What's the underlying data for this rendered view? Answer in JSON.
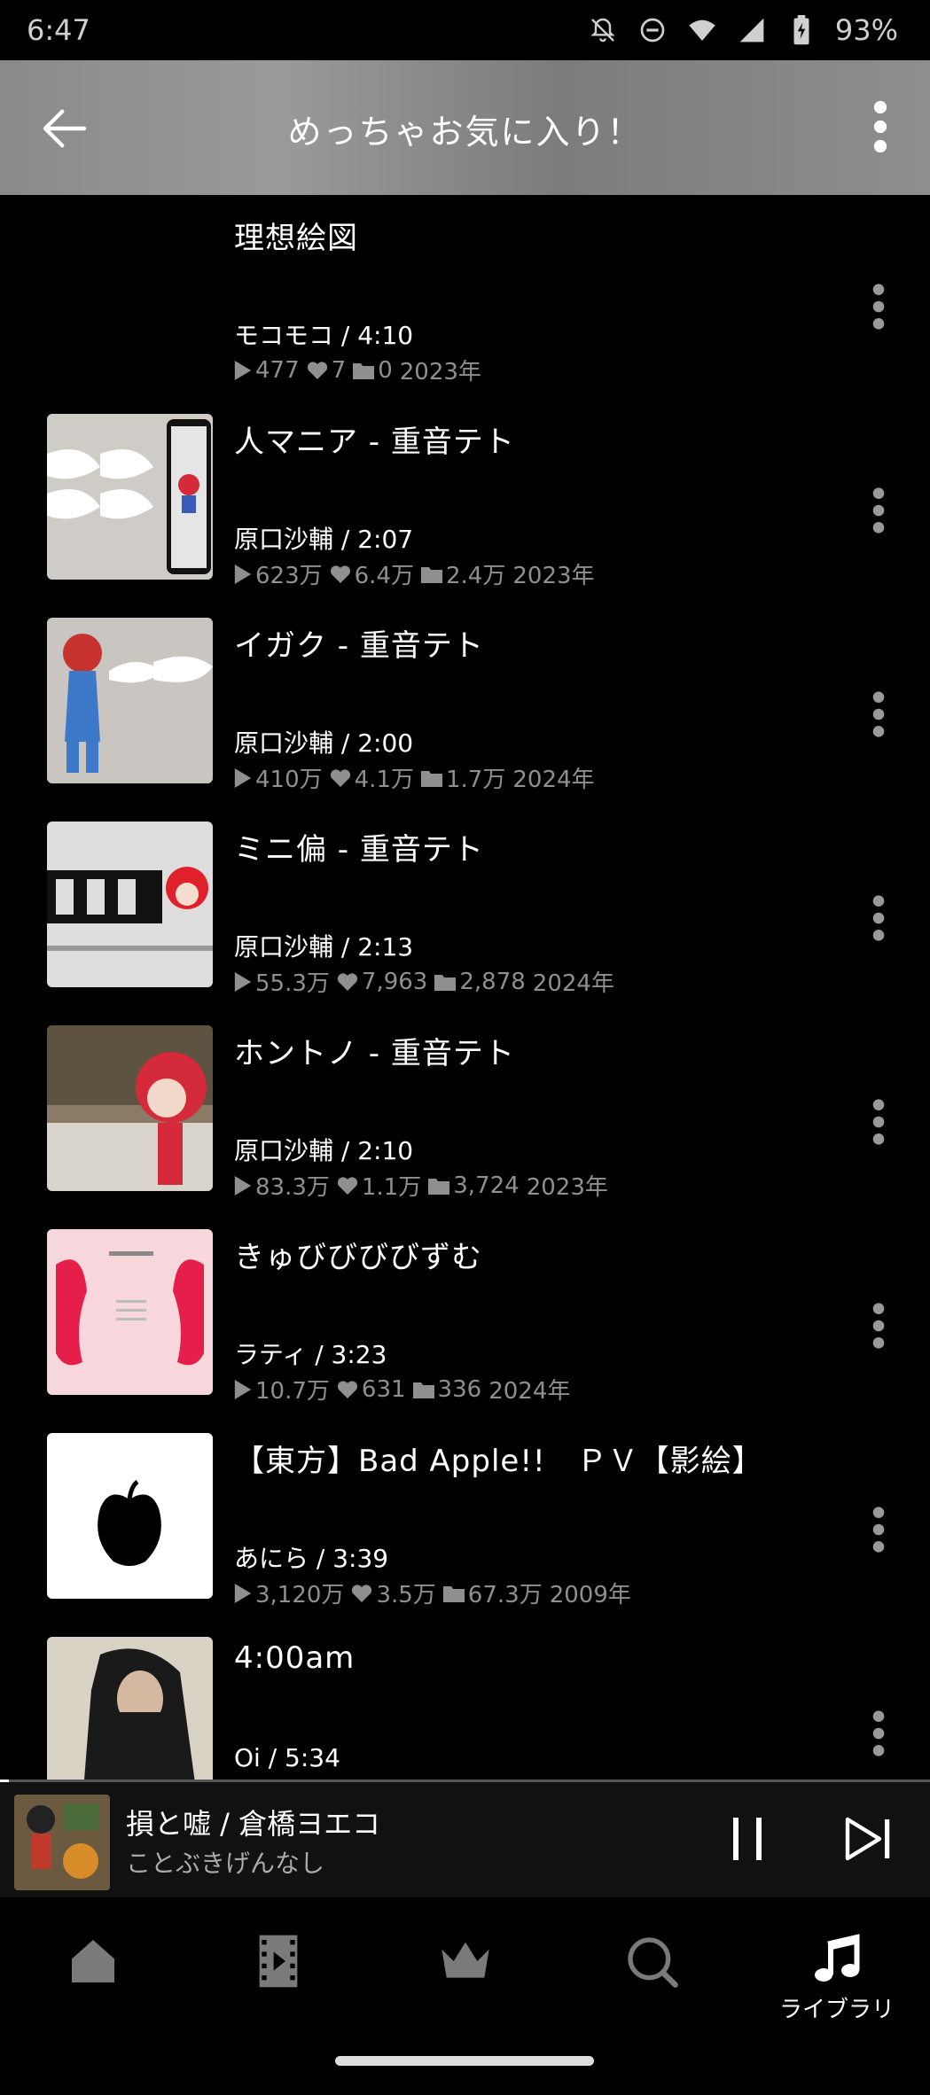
{
  "status_bar": {
    "time": "6:47",
    "battery": "93%",
    "icons": [
      "notifications-off-icon",
      "do-not-disturb-icon",
      "wifi-icon",
      "cell-signal-icon",
      "battery-charging-icon"
    ]
  },
  "header": {
    "title": "めっちゃお気に入り！",
    "back_icon": "arrow-left-icon",
    "more_icon": "more-vertical-icon"
  },
  "songs": [
    {
      "title": "理想絵図",
      "artist_duration": "モコモコ / 4:10",
      "plays": "477",
      "likes": "7",
      "mylists": "0",
      "year": "2023年",
      "has_thumb": false
    },
    {
      "title": "人マニア - 重音テト",
      "artist_duration": "原口沙輔 / 2:07",
      "plays": "623万",
      "likes": "6.4万",
      "mylists": "2.4万",
      "year": "2023年",
      "has_thumb": true
    },
    {
      "title": "イガク - 重音テト",
      "artist_duration": "原口沙輔 / 2:00",
      "plays": "410万",
      "likes": "4.1万",
      "mylists": "1.7万",
      "year": "2024年",
      "has_thumb": true
    },
    {
      "title": "ミニ偏 - 重音テト",
      "artist_duration": "原口沙輔 / 2:13",
      "plays": "55.3万",
      "likes": "7,963",
      "mylists": "2,878",
      "year": "2024年",
      "has_thumb": true
    },
    {
      "title": "ホントノ - 重音テト",
      "artist_duration": "原口沙輔 / 2:10",
      "plays": "83.3万",
      "likes": "1.1万",
      "mylists": "3,724",
      "year": "2023年",
      "has_thumb": true
    },
    {
      "title": "きゅびびびびずむ",
      "artist_duration": "ラティ / 3:23",
      "plays": "10.7万",
      "likes": "631",
      "mylists": "336",
      "year": "2024年",
      "has_thumb": true
    },
    {
      "title": "【東方】Bad Apple!!　ＰＶ【影絵】",
      "artist_duration": "あにら / 3:39",
      "plays": "3,120万",
      "likes": "3.5万",
      "mylists": "67.3万",
      "year": "2009年",
      "has_thumb": true
    },
    {
      "title": "4:00am",
      "artist_duration": "Oi / 5:34",
      "plays": "",
      "likes": "",
      "mylists": "",
      "year": "",
      "has_thumb": true
    }
  ],
  "now_playing": {
    "title": "損と嘘 / 倉橋ヨエコ",
    "artist": "ことぶきげんなし",
    "progress": 0.01,
    "pause_icon": "pause-icon",
    "next_icon": "skip-next-icon"
  },
  "bottom_nav": {
    "items": [
      {
        "icon": "home-icon",
        "label": ""
      },
      {
        "icon": "video-icon",
        "label": ""
      },
      {
        "icon": "crown-icon",
        "label": ""
      },
      {
        "icon": "search-icon",
        "label": ""
      },
      {
        "icon": "music-note-icon",
        "label": "ライブラリ",
        "active": true
      }
    ]
  }
}
